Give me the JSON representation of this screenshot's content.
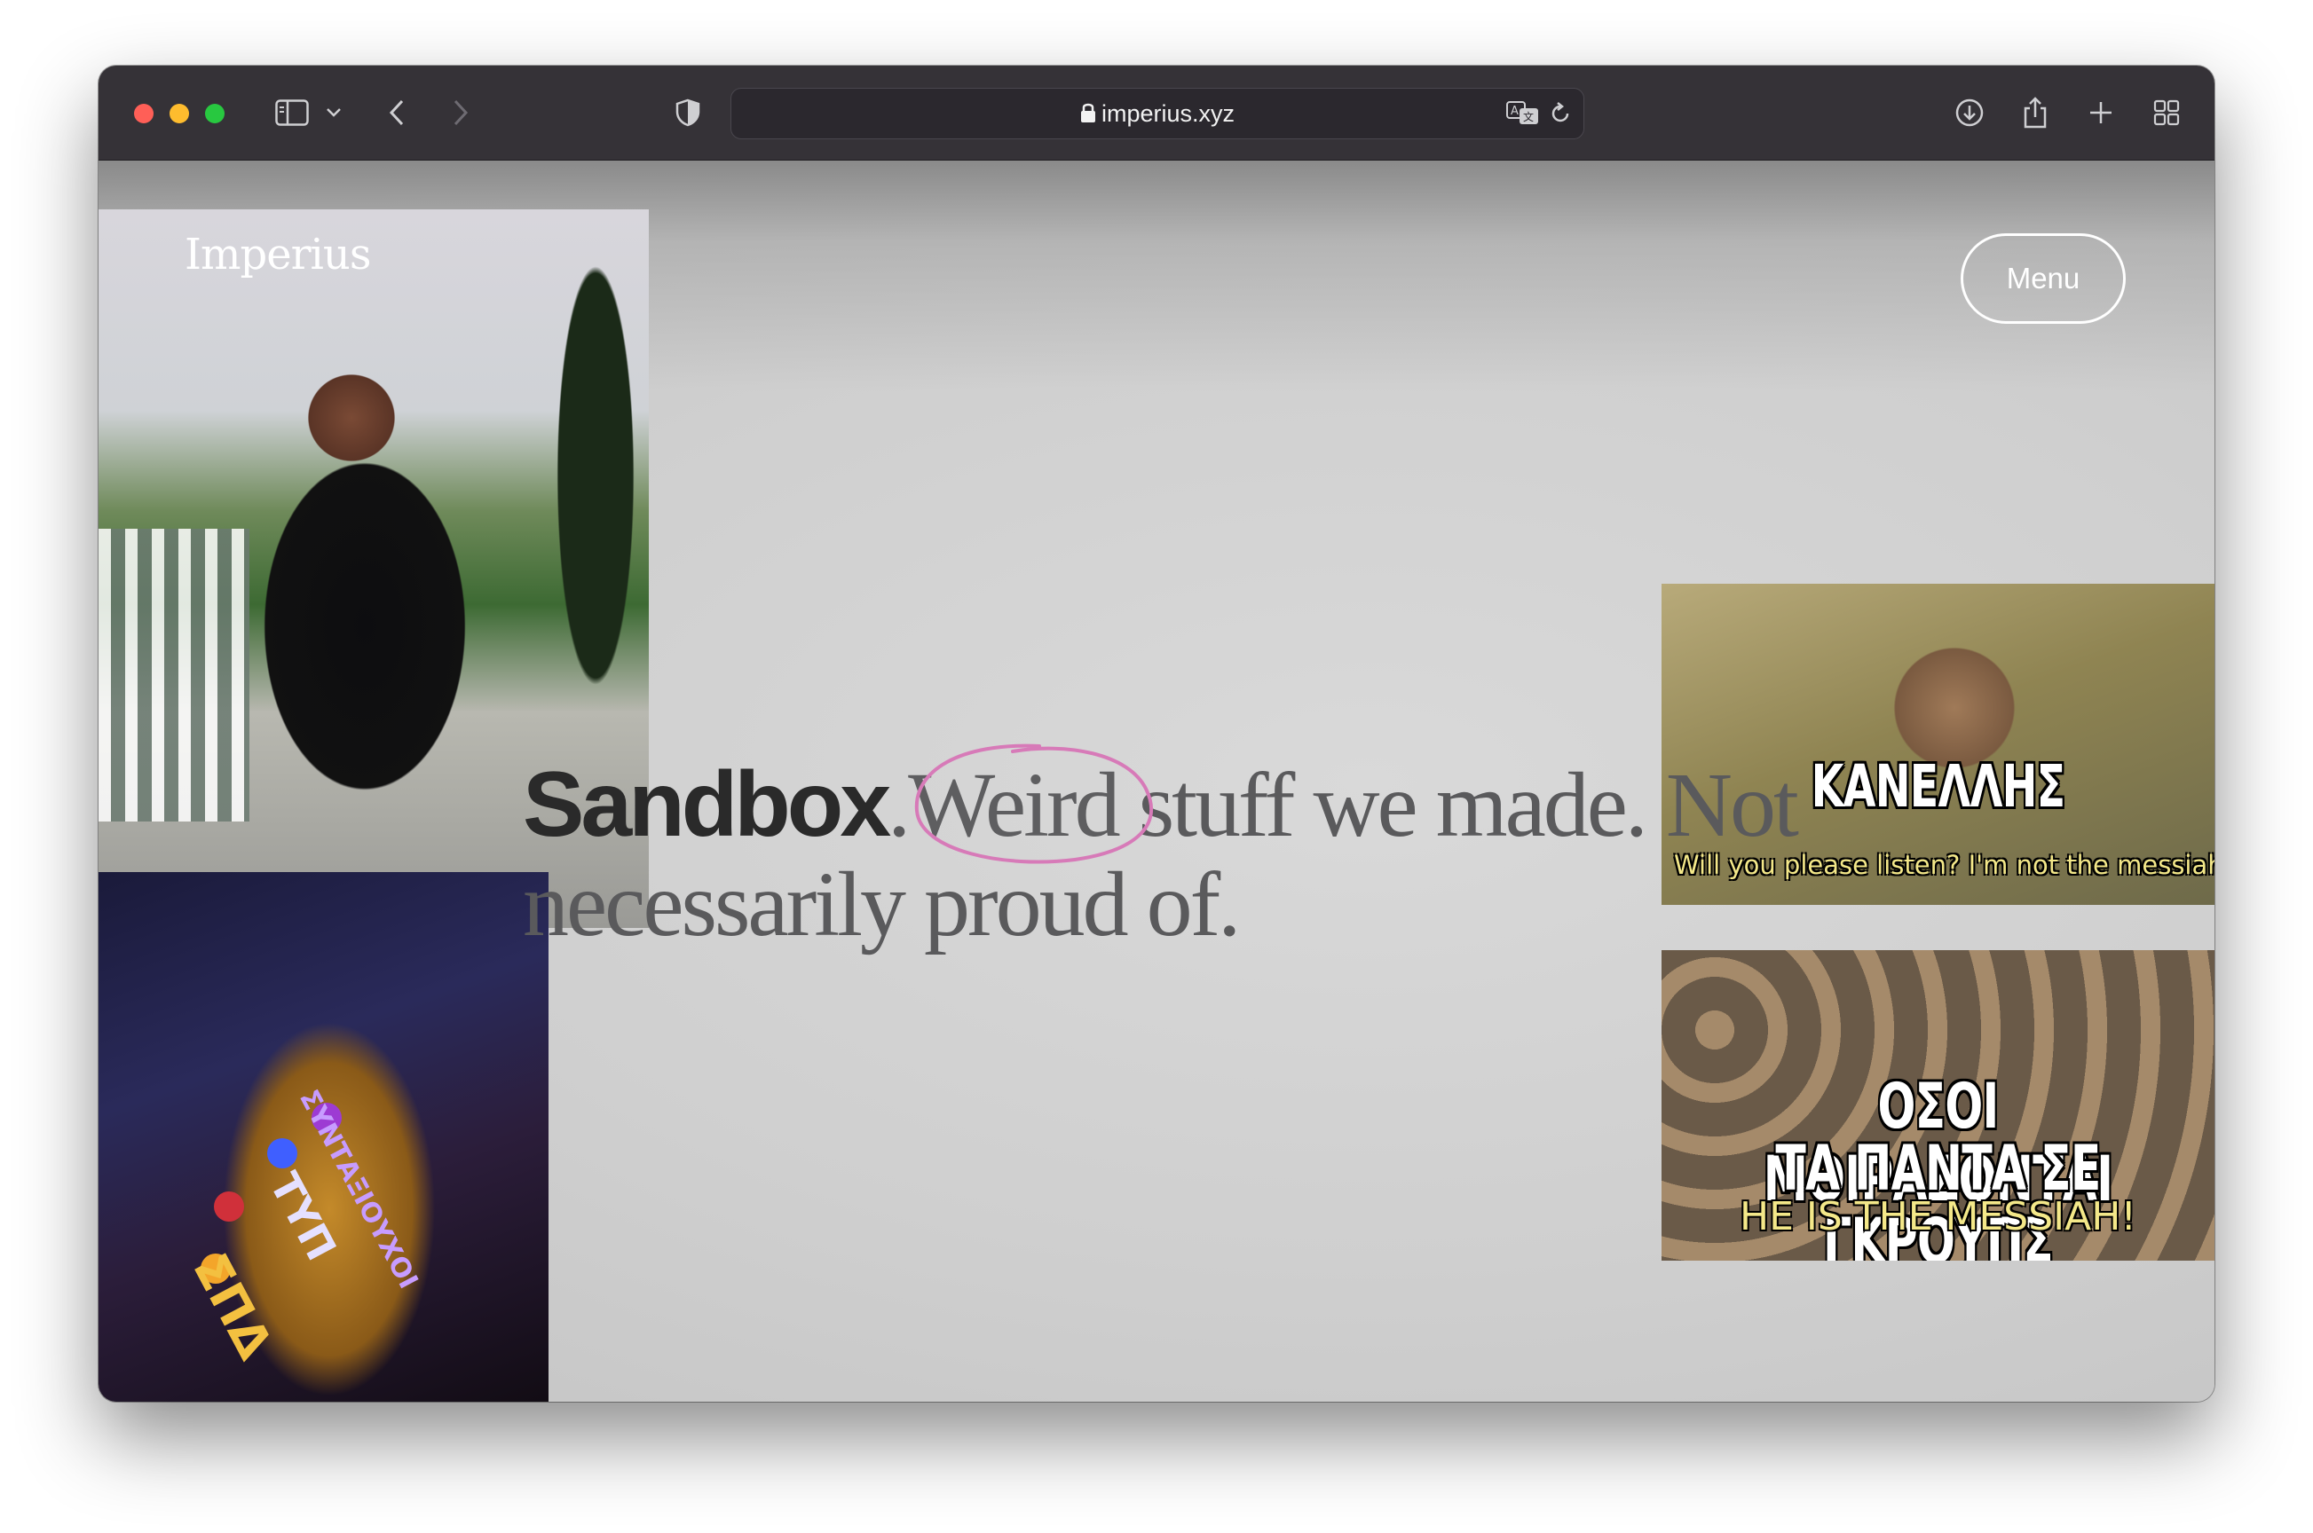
{
  "browser": {
    "url": "imperius.xyz",
    "icons": {
      "sidebar": "sidebar-icon",
      "back": "chevron-left-icon",
      "forward": "chevron-right-icon",
      "shield": "shield-icon",
      "translate": "translate-icon",
      "reload": "reload-icon",
      "downloads": "download-icon",
      "share": "share-icon",
      "new_tab": "plus-icon",
      "tab_overview": "grid-icon"
    }
  },
  "site": {
    "logo": "Imperius",
    "menu_label": "Menu",
    "headline": {
      "strong": "Sandbox",
      "dot": ".",
      "highlight": "Weird",
      "rest": " stuff we made. Not necessarily proud of."
    },
    "accent_color": "#d77ab8"
  },
  "memes": {
    "thanos": {
      "caption_1": "ΣΥΝΤΑΞΙΟΥΧΟΙ",
      "caption_2": "ΤΥΠ",
      "caption_3": "ΣΠΔ"
    },
    "messiah_1": {
      "title": "ΚΑΝΕΛΛΗΣ",
      "subtitle": "Will you please listen? I'm not the messiah"
    },
    "messiah_2": {
      "title_line_1": "ΟΣΟΙ ΜΟΙΡΑΖΟΝΤΑΙ",
      "title_line_2": "ΤΑ ΠΑΝΤΑ ΣΕ ΓΚΡΟΥΠΣ",
      "subtitle": "HE IS THE MESSIAH!"
    }
  }
}
